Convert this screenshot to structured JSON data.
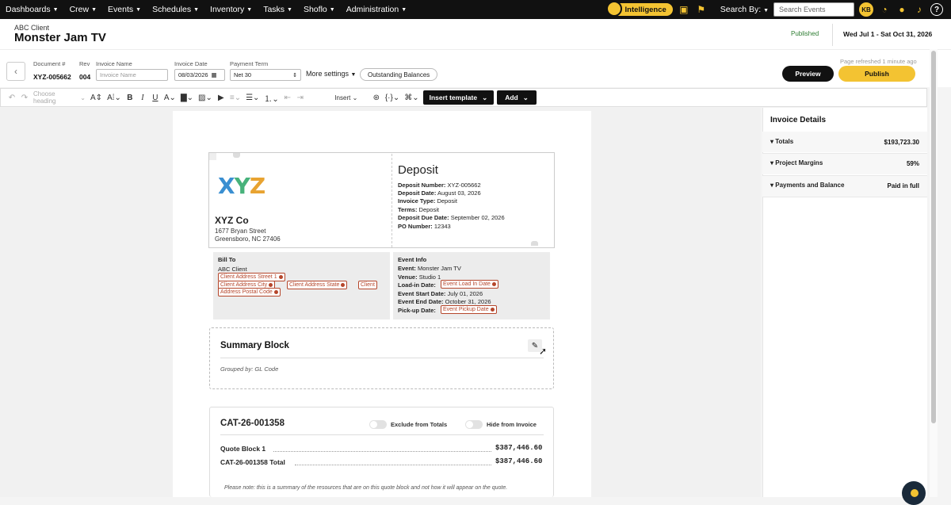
{
  "nav": {
    "items": [
      "Dashboards",
      "Crew",
      "Events",
      "Schedules",
      "Inventory",
      "Tasks",
      "Shoflo",
      "Administration"
    ],
    "intelligence_label": "Intelligence",
    "search_by_label": "Search By:",
    "search_placeholder": "Search Events",
    "user_initials": "KB",
    "help_label": "?"
  },
  "header": {
    "client": "ABC Client",
    "event_title": "Monster Jam TV",
    "status": "Published",
    "date_range": "Wed Jul 1 - Sat Oct 31, 2026"
  },
  "invoice_bar": {
    "document_label": "Document #",
    "document_value": "XYZ-005662",
    "rev_label": "Rev",
    "rev_value": "004",
    "invoice_name_label": "Invoice Name",
    "invoice_name_placeholder": "Invoice Name",
    "invoice_date_label": "Invoice Date",
    "invoice_date_value": "08/03/2026",
    "payment_term_label": "Payment Term",
    "payment_term_value": "Net 30",
    "more_settings": "More settings",
    "outstanding_balances": "Outstanding Balances",
    "refreshed": "Page refreshed 1 minute ago",
    "preview": "Preview",
    "publish": "Publish"
  },
  "toolbar": {
    "heading_placeholder": "Choose heading",
    "insert_label": "Insert",
    "insert_template": "Insert template",
    "add": "Add"
  },
  "document": {
    "logo_letters": [
      "X",
      "Y",
      "Z"
    ],
    "company_name": "XYZ Co",
    "address_line1": "1677 Bryan Street",
    "address_line2": "Greensboro, NC 27406",
    "deposit_title": "Deposit",
    "deposit_fields": [
      {
        "label": "Deposit Number:",
        "value": "XYZ-005662"
      },
      {
        "label": "Deposit Date:",
        "value": "August 03, 2026"
      },
      {
        "label": "Invoice Type:",
        "value": "Deposit"
      },
      {
        "label": "Terms:",
        "value": "Deposit"
      },
      {
        "label": "Deposit Due Date:",
        "value": "September 02, 2026"
      },
      {
        "label": "PO Number:",
        "value": "12343"
      }
    ],
    "bill_to": {
      "title": "Bill To",
      "client": "ABC Client",
      "tags": [
        "Client Address Street 1",
        "Client Address City",
        "Client Address State",
        "Client",
        "Address Postal Code"
      ]
    },
    "event_info": {
      "title": "Event Info",
      "event_label": "Event:",
      "event_value": "Monster Jam TV",
      "venue_label": "Venue:",
      "venue_value": "Studio 1",
      "loadin_label": "Load-in Date:",
      "loadin_tag": "Event Load In Date",
      "start_label": "Event Start Date:",
      "start_value": "July 01, 2026",
      "end_label": "Event End Date:",
      "end_value": "October 31, 2026",
      "pickup_label": "Pick-up Date:",
      "pickup_tag": "Event Pickup Date"
    },
    "summary": {
      "title": "Summary Block",
      "grouped_by": "Grouped by: GL Code"
    },
    "cat": {
      "title": "CAT-26-001358",
      "exclude_label": "Exclude from Totals",
      "hide_label": "Hide from Invoice",
      "rows": [
        {
          "label": "Quote Block 1",
          "value": "$387,446.60"
        },
        {
          "label": "CAT-26-001358 Total",
          "value": "$387,446.60"
        }
      ],
      "note": "Please note: this is a summary of the resources that are on this quote block and not how it will appear on the quote."
    }
  },
  "invoice_details": {
    "title": "Invoice Details",
    "rows": [
      {
        "label": "Totals",
        "value": "$193,723.30"
      },
      {
        "label": "Project Margins",
        "value": "59%"
      },
      {
        "label": "Payments and Balance",
        "value": "Paid in full"
      }
    ]
  },
  "colors": {
    "accent": "#f3c332",
    "tag": "#b5462b",
    "published": "#2e7d32"
  }
}
